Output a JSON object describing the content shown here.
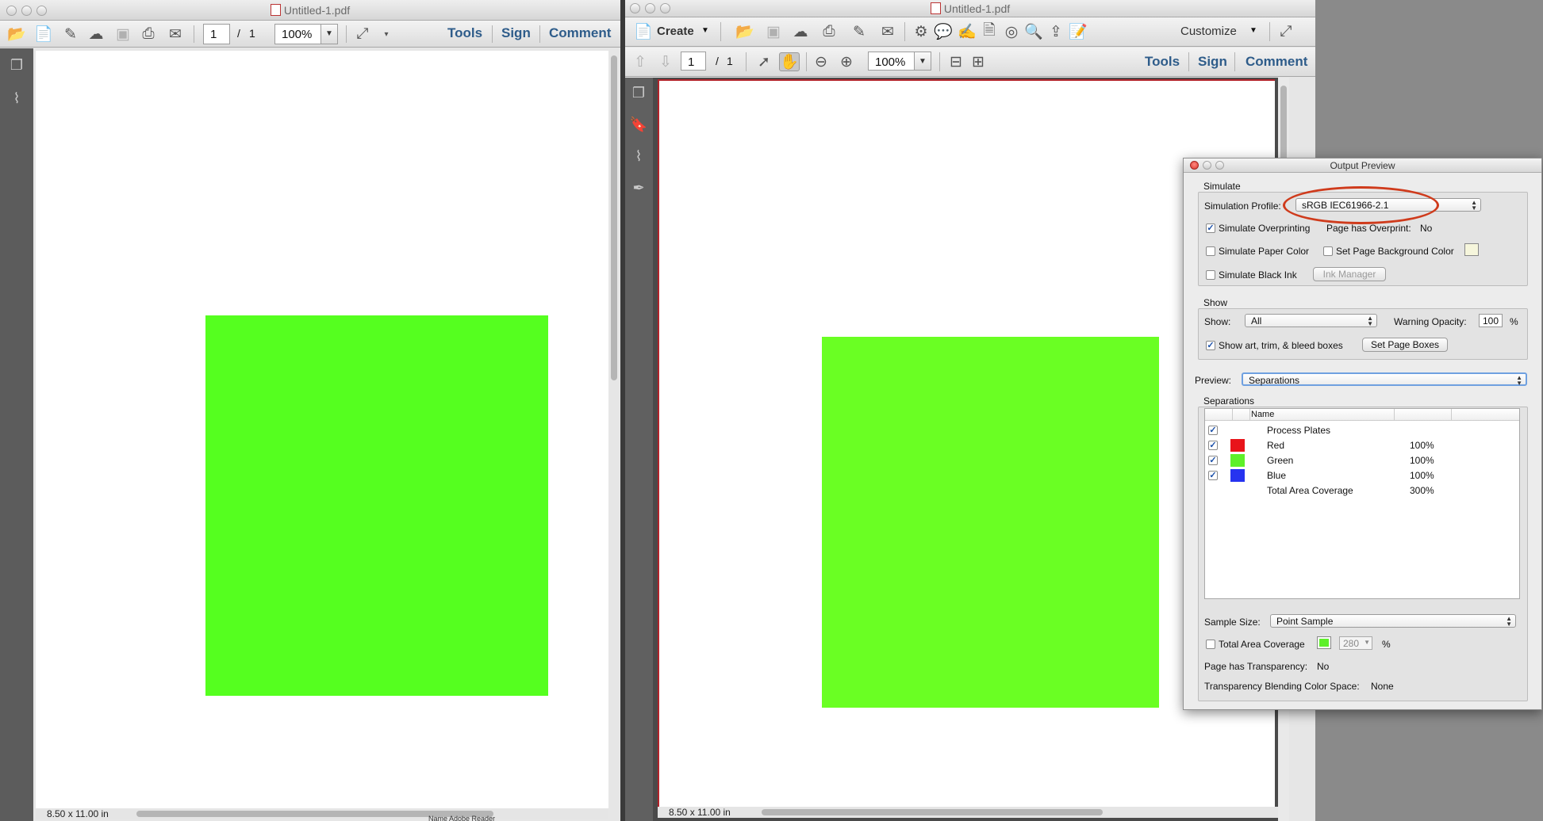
{
  "left_window": {
    "title": "Untitled-1.pdf",
    "page_current": "1",
    "page_sep": "/",
    "page_total": "1",
    "zoom": "100%",
    "tools_label": "Tools",
    "sign_label": "Sign",
    "comment_label": "Comment",
    "page_size": "8.50 x 11.00 in",
    "shape_color": "#55ff1f"
  },
  "right_window": {
    "title": "Untitled-1.pdf",
    "create_label": "Create",
    "customize_label": "Customize",
    "page_current": "1",
    "page_sep": "/",
    "page_total": "1",
    "zoom": "100%",
    "tools_label": "Tools",
    "sign_label": "Sign",
    "comment_label": "Comment",
    "page_size": "8.50 x 11.00 in",
    "shape_color": "#6aff23"
  },
  "output_preview": {
    "title": "Output Preview",
    "simulate_heading": "Simulate",
    "simulation_profile_label": "Simulation Profile:",
    "simulation_profile_value": "sRGB IEC61966-2.1",
    "simulate_overprinting": "Simulate Overprinting",
    "page_has_overprint_label": "Page has Overprint:",
    "page_has_overprint_value": "No",
    "simulate_paper_color": "Simulate Paper Color",
    "set_page_background_color": "Set Page Background Color",
    "simulate_black_ink": "Simulate Black Ink",
    "ink_manager": "Ink Manager",
    "show_heading": "Show",
    "show_label": "Show:",
    "show_value": "All",
    "warning_opacity_label": "Warning Opacity:",
    "warning_opacity_value": "100",
    "percent": "%",
    "show_boxes": "Show art, trim, & bleed boxes",
    "set_page_boxes": "Set Page Boxes",
    "preview_label": "Preview:",
    "preview_value": "Separations",
    "separations_heading": "Separations",
    "name_column": "Name",
    "separations": [
      {
        "name": "Process Plates",
        "value": "",
        "color": ""
      },
      {
        "name": "Red",
        "value": "100%",
        "color": "#e8141a"
      },
      {
        "name": "Green",
        "value": "100%",
        "color": "#5ef02a"
      },
      {
        "name": "Blue",
        "value": "100%",
        "color": "#2633f0"
      },
      {
        "name": "Total Area Coverage",
        "value": "300%",
        "color": ""
      }
    ],
    "sample_size_label": "Sample Size:",
    "sample_size_value": "Point Sample",
    "total_area_coverage": "Total Area Coverage",
    "tac_value": "280",
    "page_has_transparency_label": "Page has Transparency:",
    "page_has_transparency_value": "No",
    "blending_label": "Transparency Blending Color Space:",
    "blending_value": "None"
  },
  "background_fragment": "Name   Adobe Reader"
}
